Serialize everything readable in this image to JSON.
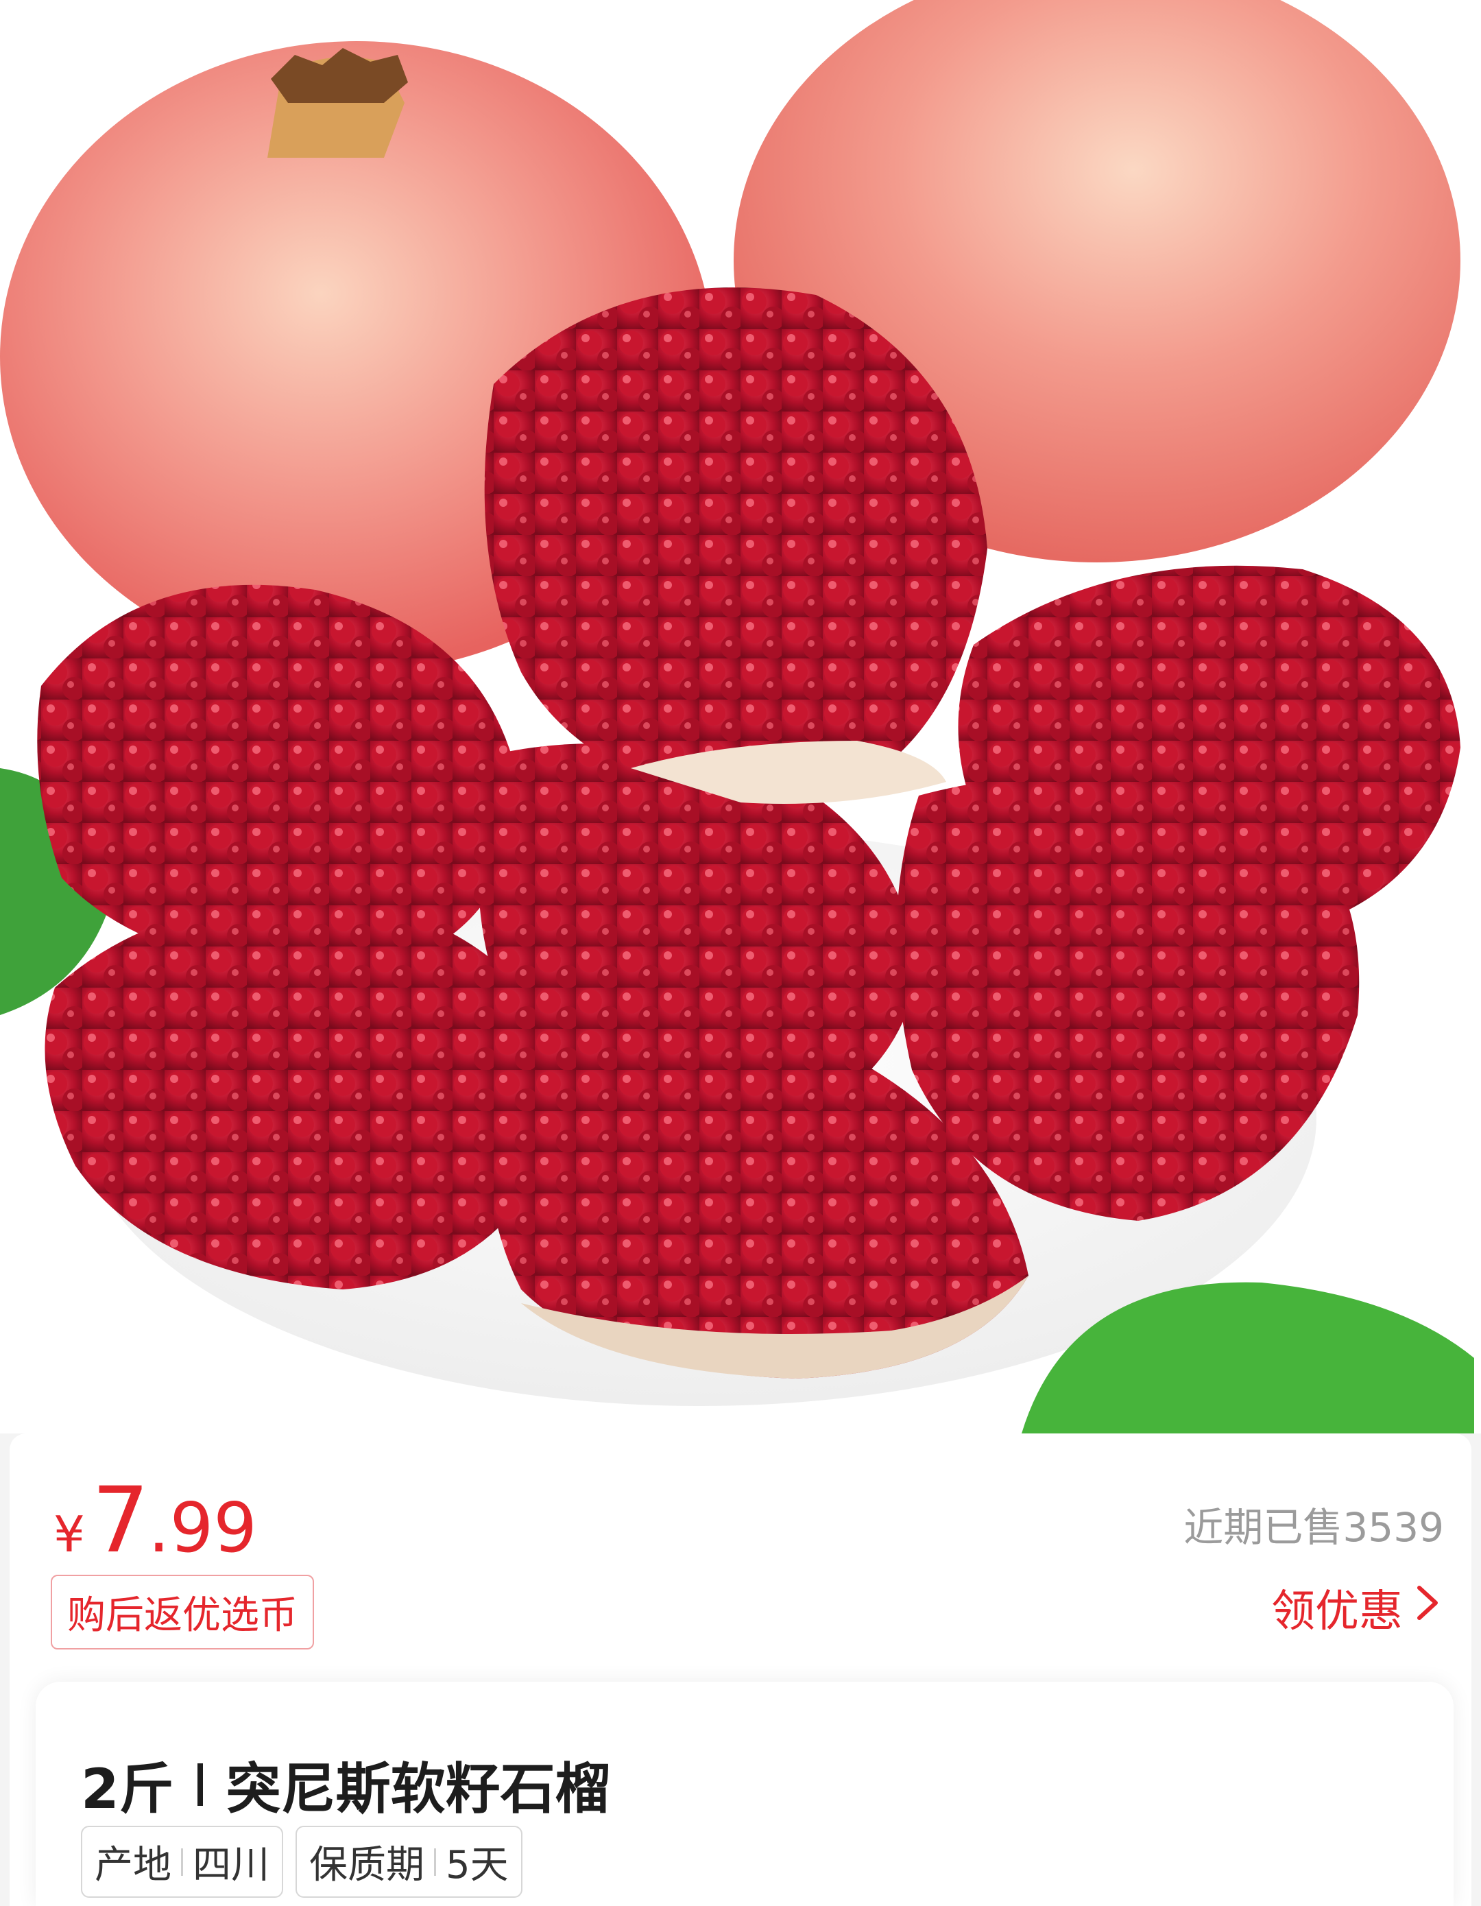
{
  "hero": {
    "image_alt": "pomegranate-photo"
  },
  "price": {
    "currency": "¥",
    "integer": "7",
    "decimal": ".99",
    "sold_text": "近期已售3539",
    "coin_tag": "购后返优选币",
    "coupon_label": "领优惠",
    "coupon_icon": "chevron-right-icon"
  },
  "product": {
    "weight": "2斤",
    "name": "突尼斯软籽石榴",
    "attributes": [
      {
        "label": "产地",
        "value": "四川"
      },
      {
        "label": "保质期",
        "value": "5天"
      }
    ]
  },
  "colors": {
    "accent": "#e5262c",
    "muted": "#9b9b9b"
  }
}
